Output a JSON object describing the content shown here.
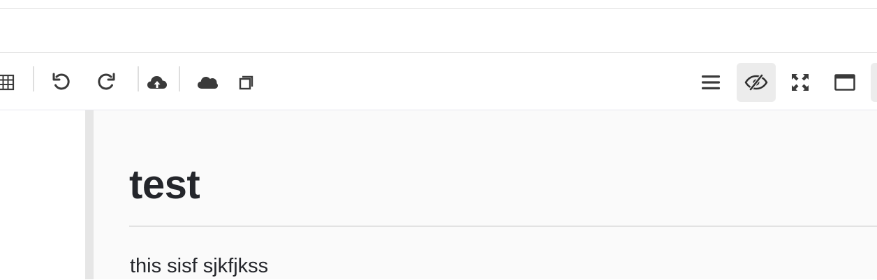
{
  "toolbar": {
    "left_buttons": [
      {
        "name": "table-icon"
      },
      {
        "name": "undo-icon"
      },
      {
        "name": "redo-icon"
      },
      {
        "name": "cloud-upload-icon"
      },
      {
        "name": "cloud-icon"
      },
      {
        "name": "copy-icon"
      }
    ],
    "right_buttons": [
      {
        "name": "menu-icon"
      },
      {
        "name": "preview-toggle-icon",
        "active": true
      },
      {
        "name": "fullscreen-icon"
      },
      {
        "name": "window-icon"
      }
    ]
  },
  "document": {
    "title": "test",
    "paragraph": "this sisf sjkfjkss"
  },
  "colors": {
    "icon": "#3a3a3a",
    "active_bg": "#ececec",
    "preview_bg": "#fafafa",
    "gutter": "#e6e6e6"
  }
}
